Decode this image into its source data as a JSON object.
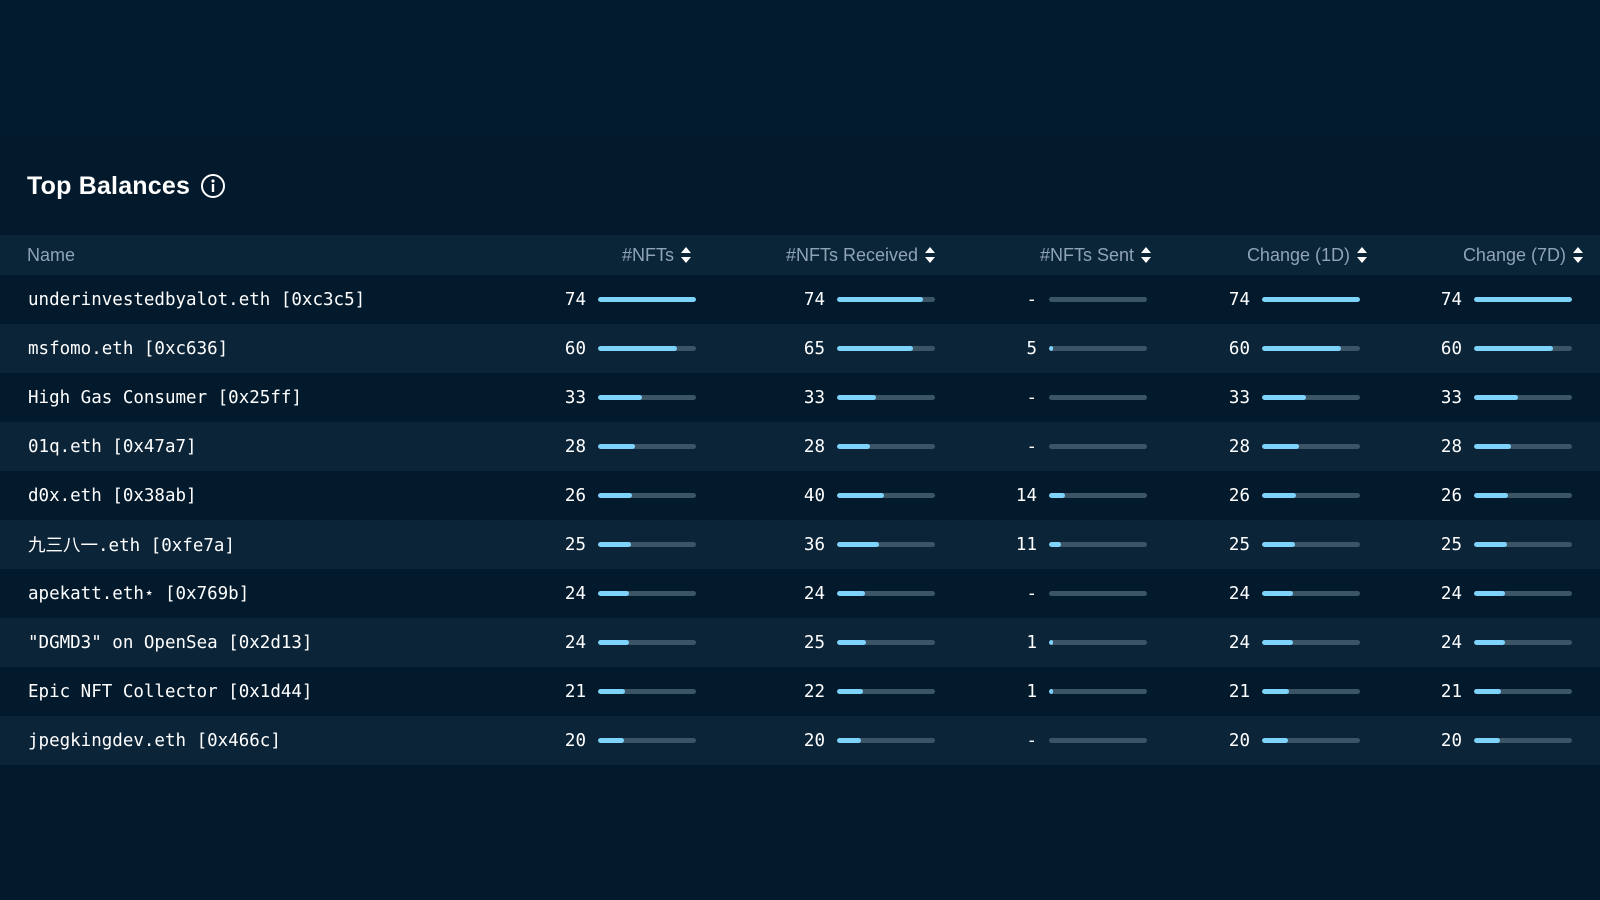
{
  "title": "Top Balances",
  "icons": {
    "info": "info-icon",
    "sort": "sort-icon"
  },
  "colors": {
    "bar_fill": "#7dd3fc",
    "bar_track": "#3b5466",
    "background": "#031a2c"
  },
  "columns": {
    "name": "Name",
    "nfts": "#NFTs",
    "received": "#NFTs Received",
    "sent": "#NFTs Sent",
    "change_1d": "Change (1D)",
    "change_7d": "Change (7D)"
  },
  "rows": [
    {
      "name": "underinvestedbyalot.eth [0xc3c5]",
      "nfts": "74",
      "received": "74",
      "sent": "-",
      "change_1d": "74",
      "change_7d": "74",
      "bars": {
        "nfts": 1.0,
        "received": 0.88,
        "sent": 0.0,
        "change_1d": 1.0,
        "change_7d": 1.0
      }
    },
    {
      "name": "msfomo.eth [0xc636]",
      "nfts": "60",
      "received": "65",
      "sent": "5",
      "change_1d": "60",
      "change_7d": "60",
      "bars": {
        "nfts": 0.81,
        "received": 0.78,
        "sent": 0.04,
        "change_1d": 0.81,
        "change_7d": 0.81
      }
    },
    {
      "name": "High Gas Consumer [0x25ff]",
      "nfts": "33",
      "received": "33",
      "sent": "-",
      "change_1d": "33",
      "change_7d": "33",
      "bars": {
        "nfts": 0.45,
        "received": 0.4,
        "sent": 0.0,
        "change_1d": 0.45,
        "change_7d": 0.45
      }
    },
    {
      "name": "01q.eth [0x47a7]",
      "nfts": "28",
      "received": "28",
      "sent": "-",
      "change_1d": "28",
      "change_7d": "28",
      "bars": {
        "nfts": 0.38,
        "received": 0.34,
        "sent": 0.0,
        "change_1d": 0.38,
        "change_7d": 0.38
      }
    },
    {
      "name": "d0x.eth [0x38ab]",
      "nfts": "26",
      "received": "40",
      "sent": "14",
      "change_1d": "26",
      "change_7d": "26",
      "bars": {
        "nfts": 0.35,
        "received": 0.48,
        "sent": 0.16,
        "change_1d": 0.35,
        "change_7d": 0.35
      }
    },
    {
      "name": "九三八一.eth [0xfe7a]",
      "nfts": "25",
      "received": "36",
      "sent": "11",
      "change_1d": "25",
      "change_7d": "25",
      "bars": {
        "nfts": 0.34,
        "received": 0.43,
        "sent": 0.12,
        "change_1d": 0.34,
        "change_7d": 0.34
      }
    },
    {
      "name": "apekatt.eth⋆ [0x769b]",
      "nfts": "24",
      "received": "24",
      "sent": "-",
      "change_1d": "24",
      "change_7d": "24",
      "bars": {
        "nfts": 0.32,
        "received": 0.29,
        "sent": 0.0,
        "change_1d": 0.32,
        "change_7d": 0.32
      }
    },
    {
      "name": "\"DGMD3\" on OpenSea [0x2d13]",
      "nfts": "24",
      "received": "25",
      "sent": "1",
      "change_1d": "24",
      "change_7d": "24",
      "bars": {
        "nfts": 0.32,
        "received": 0.3,
        "sent": 0.01,
        "change_1d": 0.32,
        "change_7d": 0.32
      }
    },
    {
      "name": "Epic NFT Collector [0x1d44]",
      "nfts": "21",
      "received": "22",
      "sent": "1",
      "change_1d": "21",
      "change_7d": "21",
      "bars": {
        "nfts": 0.28,
        "received": 0.27,
        "sent": 0.01,
        "change_1d": 0.28,
        "change_7d": 0.28
      }
    },
    {
      "name": "jpegkingdev.eth [0x466c]",
      "nfts": "20",
      "received": "20",
      "sent": "-",
      "change_1d": "20",
      "change_7d": "20",
      "bars": {
        "nfts": 0.27,
        "received": 0.24,
        "sent": 0.0,
        "change_1d": 0.27,
        "change_7d": 0.27
      }
    }
  ]
}
